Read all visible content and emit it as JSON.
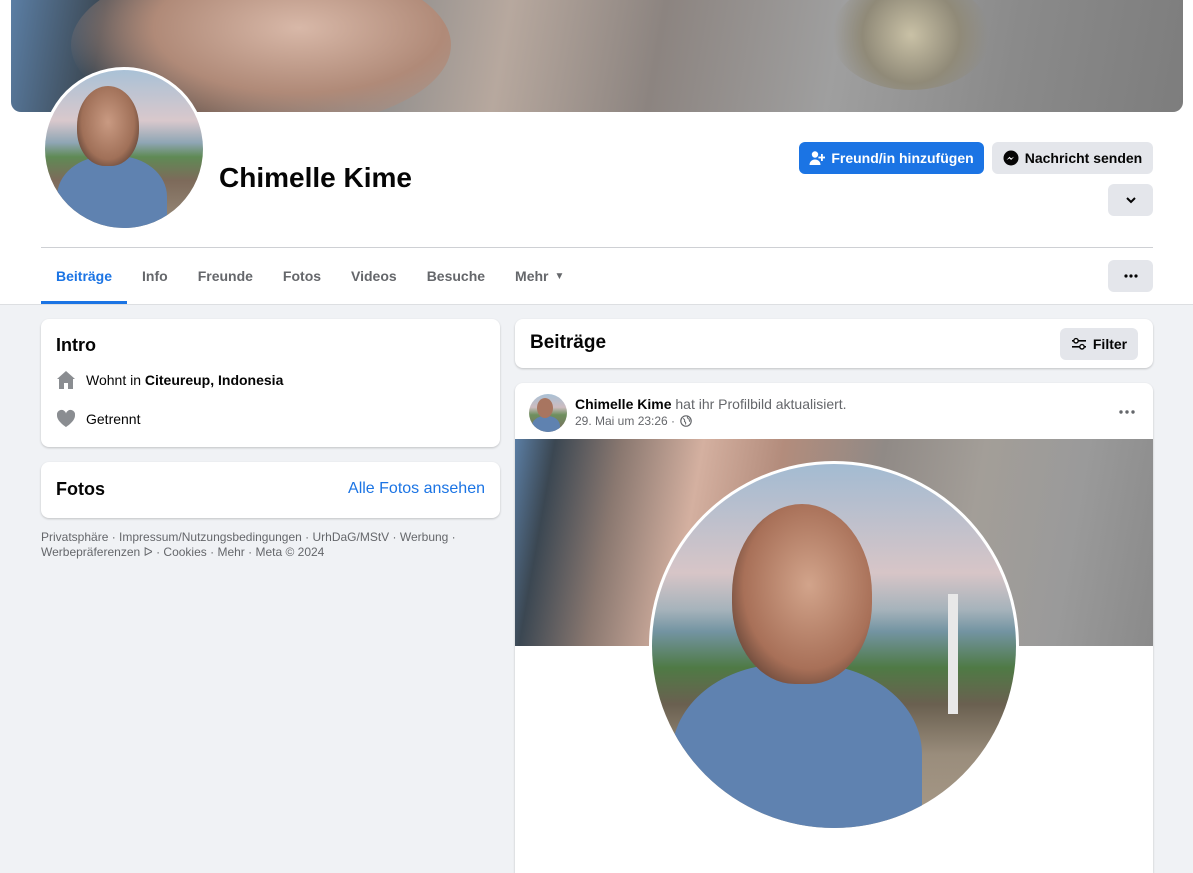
{
  "profile": {
    "name": "Chimelle Kime",
    "add_friend_label": "Freund/in hinzufügen",
    "message_label": "Nachricht senden"
  },
  "tabs": [
    {
      "label": "Beiträge",
      "active": true
    },
    {
      "label": "Info"
    },
    {
      "label": "Freunde"
    },
    {
      "label": "Fotos"
    },
    {
      "label": "Videos"
    },
    {
      "label": "Besuche"
    },
    {
      "label": "Mehr"
    }
  ],
  "intro": {
    "title": "Intro",
    "lives_prefix": "Wohnt in ",
    "lives_location": "Citeureup, Indonesia",
    "relationship": "Getrennt"
  },
  "photos": {
    "title": "Fotos",
    "all_link": "Alle Fotos ansehen"
  },
  "footer": {
    "items": [
      "Privatsphäre",
      "Impressum/Nutzungsbedingungen",
      "UrhDaG/MStV",
      "Werbung",
      "Werbepräferenzen",
      "Cookies",
      "Mehr",
      "Meta © 2024"
    ]
  },
  "posts": {
    "title": "Beiträge",
    "filter_label": "Filter",
    "post": {
      "author": "Chimelle Kime",
      "action": " hat ihr Profilbild aktualisiert.",
      "timestamp": "29. Mai um 23:26 ·"
    }
  },
  "colors": {
    "accent": "#1b74e4",
    "background": "#f0f2f5",
    "secondary_button": "#e4e6eb"
  }
}
